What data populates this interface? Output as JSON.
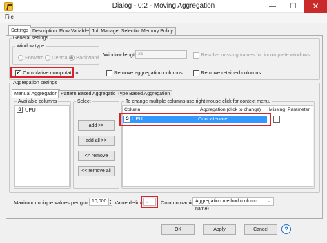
{
  "window": {
    "title": "Dialog - 0:2 - Moving Aggregation",
    "minimize": "—",
    "maximize": "☐",
    "close": "✕"
  },
  "menu": {
    "file": "File"
  },
  "tabs": [
    "Settings",
    "Description",
    "Flow Variables",
    "Job Manager Selection",
    "Memory Policy"
  ],
  "general": {
    "legend": "General settings",
    "window_type": {
      "legend": "Window type",
      "options": [
        "Forward",
        "Central",
        "Backward"
      ],
      "selected": "Backward"
    },
    "window_length_label": "Window length",
    "window_length_value": "21",
    "resolve_missing": "Resolve missing values for incomplete windows",
    "cumulative": "Cumulative computation",
    "cumulative_checked": true,
    "remove_agg": "Remove aggregation columns",
    "remove_retained": "Remove retained columns"
  },
  "aggregation": {
    "legend": "Aggregation settings",
    "tabs": [
      "Manual Aggregation",
      "Pattern Based Aggregation",
      "Type Based Aggregation"
    ],
    "available_legend": "Available columns",
    "available_columns": [
      {
        "type": "S",
        "name": "UPU"
      }
    ],
    "select_legend": "Select",
    "buttons": [
      "add >>",
      "add all >>",
      "<< remove",
      "<< remove all"
    ],
    "hint": "To change multiple columns use right mouse click for context menu.",
    "table_headers": [
      "Column",
      "Aggregation (click to change)",
      "Missing",
      "Parameter"
    ],
    "rows": [
      {
        "type": "S",
        "column": "UPU",
        "aggregation": "Concatenate",
        "missing": false,
        "parameter": ""
      }
    ]
  },
  "bottom": {
    "max_unique_label": "Maximum unique values per group",
    "max_unique_value": "10,000",
    "delimiter_label": "Value delimiter",
    "delimiter_value": ";",
    "naming_label": "Column naming",
    "naming_value": "Aggregation method (column name)"
  },
  "footer": {
    "ok": "OK",
    "apply": "Apply",
    "cancel": "Cancel",
    "help": "?"
  },
  "colors": {
    "selection": "#3399ff",
    "highlight": "#d9232a",
    "help": "#1f6fd1"
  }
}
